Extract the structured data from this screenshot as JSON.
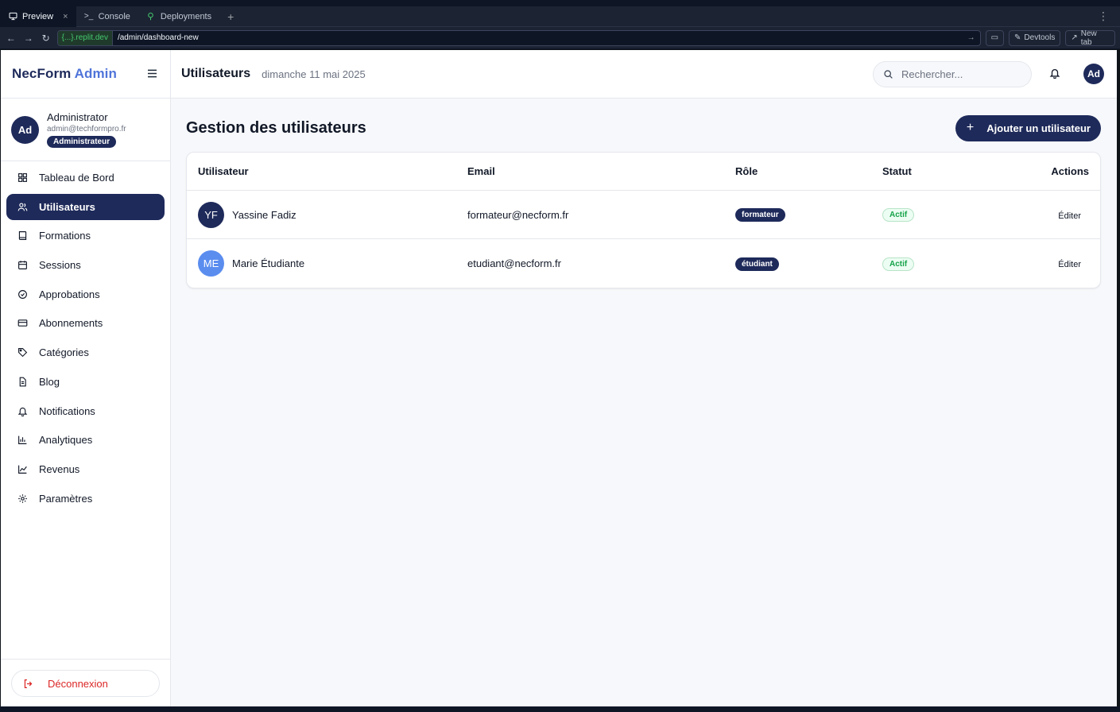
{
  "ide": {
    "tabs": [
      {
        "label": "Preview",
        "icon": "monitor-icon"
      },
      {
        "label": "Console",
        "icon": "terminal-icon"
      },
      {
        "label": "Deployments",
        "icon": "deploy-icon"
      }
    ],
    "url_host": "{...}.replit.dev",
    "url_path": "/admin/dashboard-new",
    "devtools_label": "Devtools",
    "newtab_label": "New tab"
  },
  "sidebar": {
    "brand_main": "NecForm",
    "brand_accent": "Admin",
    "user": {
      "initials": "Ad",
      "name": "Administrator",
      "email": "admin@techformpro.fr",
      "role": "Administrateur"
    },
    "items": [
      {
        "label": "Tableau de Bord",
        "icon": "grid-icon",
        "active": false
      },
      {
        "label": "Utilisateurs",
        "icon": "users-icon",
        "active": true
      },
      {
        "label": "Formations",
        "icon": "book-icon",
        "active": false
      },
      {
        "label": "Sessions",
        "icon": "calendar-icon",
        "active": false
      },
      {
        "label": "Approbations",
        "icon": "check-circle-icon",
        "active": false
      },
      {
        "label": "Abonnements",
        "icon": "credit-card-icon",
        "active": false
      },
      {
        "label": "Catégories",
        "icon": "tag-icon",
        "active": false
      },
      {
        "label": "Blog",
        "icon": "file-text-icon",
        "active": false
      },
      {
        "label": "Notifications",
        "icon": "bell-icon",
        "active": false
      },
      {
        "label": "Analytiques",
        "icon": "bar-chart-icon",
        "active": false
      },
      {
        "label": "Revenus",
        "icon": "line-chart-icon",
        "active": false
      },
      {
        "label": "Paramètres",
        "icon": "gear-icon",
        "active": false
      }
    ],
    "logout_label": "Déconnexion"
  },
  "topbar": {
    "title": "Utilisateurs",
    "date": "dimanche 11 mai 2025",
    "search_placeholder": "Rechercher...",
    "avatar_initials": "Ad"
  },
  "page": {
    "title": "Gestion des utilisateurs",
    "add_button_label": "Ajouter un utilisateur"
  },
  "table": {
    "headers": {
      "user": "Utilisateur",
      "email": "Email",
      "role": "Rôle",
      "status": "Statut",
      "actions": "Actions"
    },
    "rows": [
      {
        "initials": "YF",
        "name": "Yassine Fadiz",
        "email": "formateur@necform.fr",
        "role": "formateur",
        "status": "Actif",
        "action": "Éditer"
      },
      {
        "initials": "ME",
        "name": "Marie Étudiante",
        "email": "etudiant@necform.fr",
        "role": "étudiant",
        "status": "Actif",
        "action": "Éditer"
      }
    ]
  },
  "colors": {
    "primary": "#1e2a5a",
    "accent": "#4f74d9",
    "danger": "#dc2626",
    "success": "#16a34a"
  }
}
